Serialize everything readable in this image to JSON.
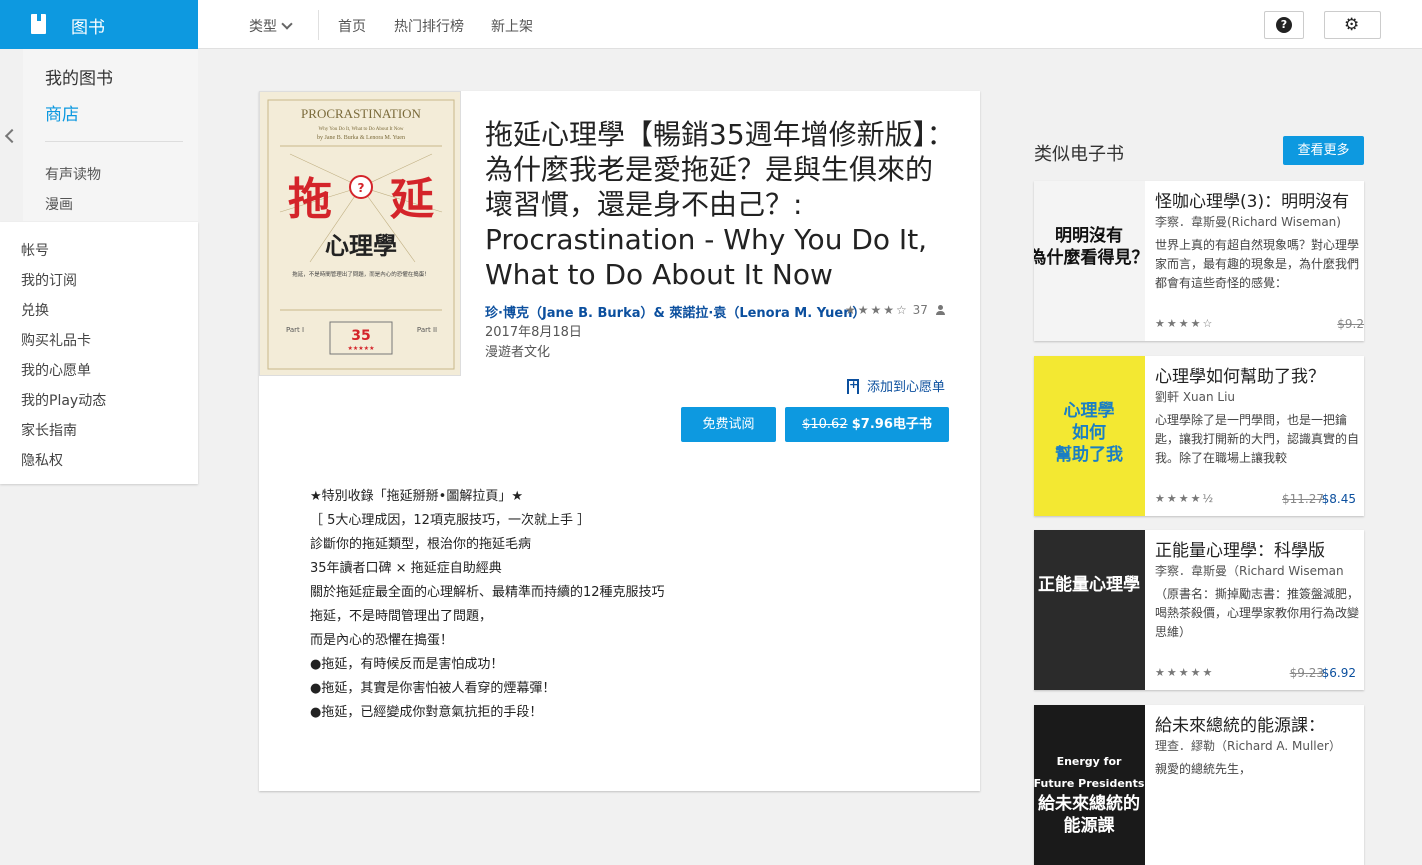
{
  "app": {
    "name": "图书"
  },
  "nav": {
    "category": "类型",
    "home": "首页",
    "top_charts": "热门排行榜",
    "new_releases": "新上架"
  },
  "sidebar": {
    "my_books": "我的图书",
    "store": "商店",
    "audiobooks": "有声读物",
    "comics": "漫画",
    "account_items": [
      "帐号",
      "我的订阅",
      "兑换",
      "购买礼品卡",
      "我的心愿单",
      "我的Play动态",
      "家长指南",
      "隐私权"
    ]
  },
  "book": {
    "title": "拖延心理學【暢銷35週年增修新版】：為什麼我老是愛拖延？是與生俱來的壞習慣，還是身不由己？: Procrastination - Why You Do It, What to Do About It Now",
    "authors": "珍·博克（Jane B. Burka）& 萊諾拉·袁（Lenora M. Yuen）",
    "rating_stars": "★★★★☆",
    "rating_count": "37",
    "date": "2017年8月18日",
    "publisher": "漫遊者文化",
    "wishlist": "添加到心愿单",
    "sample_button": "免费试阅",
    "price_old": "$10.62",
    "price_new": "$7.96电子书",
    "cover": {
      "en_title": "PROCRASTINATION",
      "en_sub": "Why You Do It, What to Do About It Now",
      "en_authors": "by Jane B. Burka & Lenora M. Yuen",
      "cn_big1": "拖",
      "cn_big2": "延",
      "cn_sub": "心理學",
      "badge": "35",
      "tag": "拖延，不是時間管理出了問題，而是內心的恐懼在搗蛋！"
    },
    "description": [
      "★特別收錄「拖延掰掰•圖解拉頁」★",
      "［ 5大心理成因，12項克服技巧，一次就上手 ］",
      "",
      "診斷你的拖延類型，根治你的拖延毛病",
      "35年讀者口碑 × 拖延症自助經典",
      "關於拖延症最全面的心理解析、最精準而持續的12種克服技巧",
      "",
      "拖延，不是時間管理出了問題，",
      "而是內心的恐懼在搗蛋！",
      "",
      "●拖延，有時候反而是害怕成功！",
      "●拖延，其實是你害怕被人看穿的煙幕彈！",
      "●拖延，已經變成你對意氣抗拒的手段！"
    ]
  },
  "similar": {
    "heading": "类似电子书",
    "more": "查看更多",
    "items": [
      {
        "title": "怪咖心理學(3)：明明沒有",
        "author": "李察．韋斯曼(Richard Wiseman)",
        "desc": "世界上真的有超自然現象嗎？對心理學家而言，最有趣的現象是，為什麼我們都會有這些奇怪的感覺：",
        "stars": "★★★★☆",
        "old": "$9.2",
        "new": "",
        "cover_text": "明明沒有\n為什麼看得見？",
        "cover_bg": "#f4f4f4",
        "cover_fg": "#111"
      },
      {
        "title": "心理學如何幫助了我？",
        "author": "劉軒 Xuan Liu",
        "desc": "心理學除了是一門學問，也是一把鑰匙，讓我打開新的大門，認識真實的自我。除了在職場上讓我較",
        "stars": "★★★★½",
        "old": "$11.27",
        "new": "$8.45",
        "cover_text": "心理學\n如何\n幫助了我",
        "cover_bg": "#f3e832",
        "cover_fg": "#1b7fc4"
      },
      {
        "title": "正能量心理學：科學版",
        "author": "李察．韋斯曼（Richard Wiseman",
        "desc": "（原書名：撕掉勵志書：推簽盤減肥，喝熱茶殺價，心理學家教你用行為改變思維）",
        "stars": "★★★★★",
        "old": "$9.23",
        "new": "$6.92",
        "cover_text": "正能量心理學",
        "cover_bg": "#2b2b2b",
        "cover_fg": "#ffffff"
      },
      {
        "title": "給未來總統的能源課：",
        "author": "理查．繆勒（Richard A. Muller）",
        "desc": "親愛的總統先生，",
        "stars": "",
        "old": "",
        "new": "",
        "cover_text": "Energy for\nFuture Presidents\n給未來總統的\n能源課",
        "cover_bg": "#1a1a1a",
        "cover_fg": "#ffffff"
      }
    ]
  }
}
